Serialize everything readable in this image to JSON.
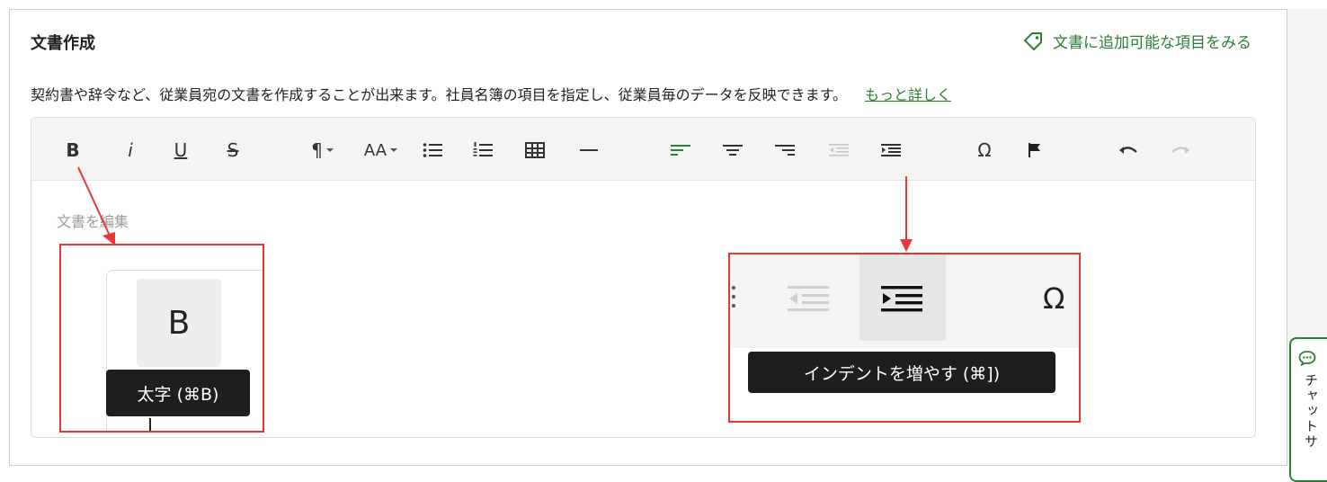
{
  "section": {
    "title": "文書作成",
    "add_items_link": "文書に追加可能な項目をみる",
    "description": "契約書や辞令など、従業員宛の文書を作成することが出来ます。社員名簿の項目を指定し、従業員毎のデータを反映できます。",
    "more_link": "もっと詳しく"
  },
  "toolbar": {
    "bold": "B",
    "italic": "i",
    "underline": "U",
    "strikethrough": "S",
    "paragraph": "¶",
    "font_size": "AA",
    "omega": "Ω"
  },
  "editor": {
    "placeholder": "文書を編集"
  },
  "callouts": {
    "bold_button": "B",
    "bold_tooltip": "太字 (⌘B)",
    "omega": "Ω",
    "indent_tooltip": "インデントを増やす (⌘])"
  },
  "chat_tab": {
    "label": "チャットサ"
  },
  "colors": {
    "accent_green": "#2e7d32",
    "annotation_red": "#e53935",
    "tooltip_bg": "#1e1e1e"
  }
}
